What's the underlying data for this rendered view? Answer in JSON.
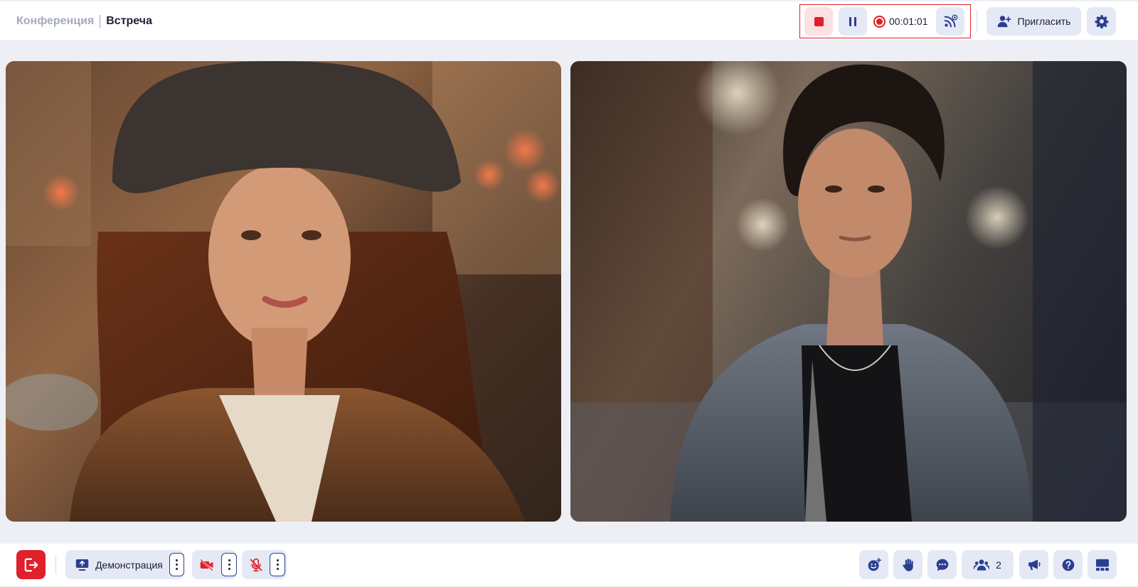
{
  "header": {
    "breadcrumb": {
      "parent": "Конференция",
      "current": "Встреча"
    },
    "recording": {
      "stop_icon": "stop-icon",
      "pause_icon": "pause-icon",
      "time": "00:01:01",
      "stream_icon": "broadcast-icon",
      "accent_color": "#e0202a"
    },
    "invite_label": "Пригласить",
    "settings_icon": "gear-icon"
  },
  "participants": [
    {
      "tile": "video-tile-1",
      "description": "woman in hat"
    },
    {
      "tile": "video-tile-2",
      "description": "man in denim jacket"
    }
  ],
  "toolbar": {
    "exit_icon": "exit-icon",
    "demo_label": "Демонстрация",
    "camera_icon": "camera-off-icon",
    "mic_icon": "mic-off-icon",
    "participants_count": "2",
    "right_icons": [
      "reaction-icon",
      "raise-hand-icon",
      "chat-icon",
      "participants-icon",
      "announce-icon",
      "help-icon",
      "layout-icon"
    ]
  },
  "colors": {
    "button_bg": "#e5e9f5",
    "icon": "#2b3f91",
    "danger": "#e0202a"
  }
}
